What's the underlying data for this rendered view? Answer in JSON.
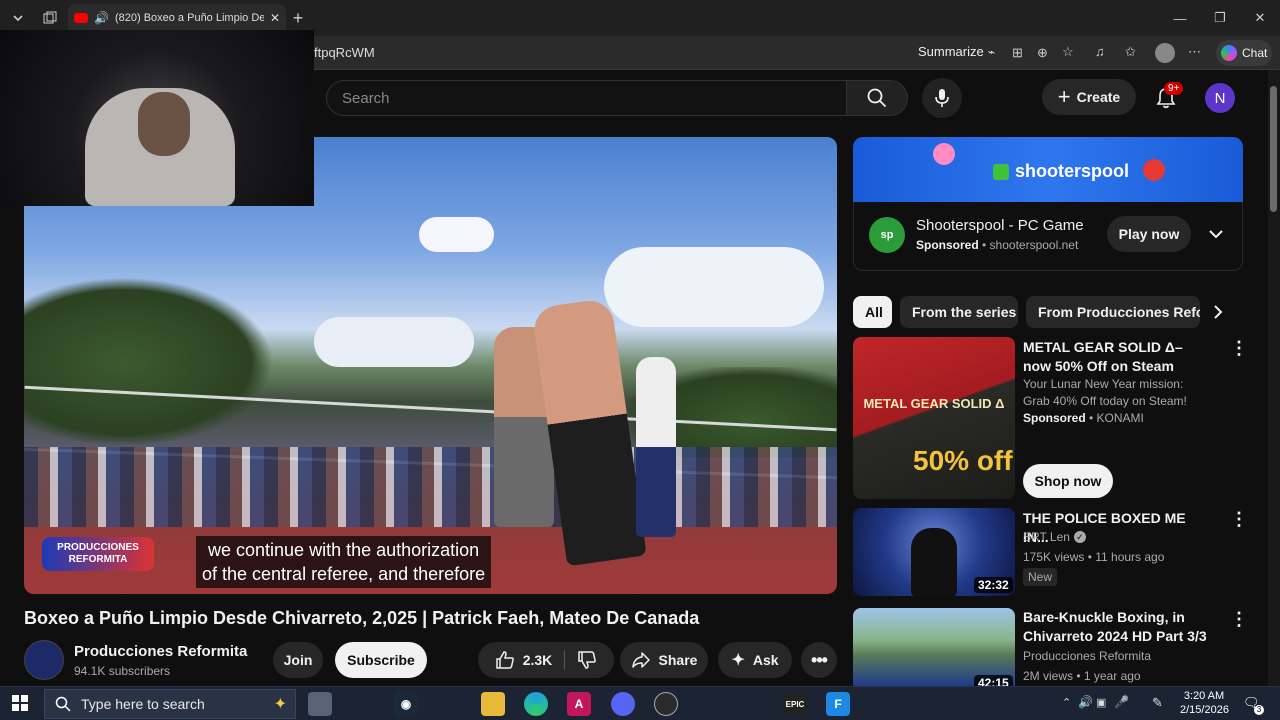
{
  "browser": {
    "tab_title": "(820) Boxeo a Puño Limpio De",
    "new_tab_symbol": "+",
    "url_fragment": "ftpqRcWM",
    "summarize_label": "Summarize",
    "chat_label": "Chat",
    "window_controls": [
      "—",
      "❐",
      "✕"
    ]
  },
  "header": {
    "search_placeholder": "Search",
    "create_label": "Create",
    "notif_badge": "9+",
    "avatar_letter": "N"
  },
  "video": {
    "caption_line1": "we continue with the authorization",
    "caption_line2": "of the central referee, and therefore",
    "watermark": "PRODUCCIONES REFORMITA",
    "title": "Boxeo a Puño Limpio Desde Chivarreto, 2,025 | Patrick Faeh, Mateo De Canada",
    "channel_name": "Producciones  Reformita",
    "subscribers": "94.1K subscribers",
    "join_label": "Join",
    "subscribe_label": "Subscribe",
    "likes": "2.3K",
    "share_label": "Share",
    "ask_label": "Ask"
  },
  "ad": {
    "banner_brand": "shooterspool",
    "title": "Shooterspool - PC Game",
    "sponsored": "Sponsored",
    "domain": "shooterspool.net",
    "cta": "Play now"
  },
  "chips": [
    "All",
    "From the series",
    "From Producciones Refor"
  ],
  "related": [
    {
      "title": "METAL GEAR SOLID Δ– now 50% Off on Steam",
      "desc": "Your Lunar New Year mission: Grab 40% Off today on Steam!",
      "sponsored": "Sponsored",
      "advertiser": "KONAMI",
      "cta": "Shop now",
      "thumb_text": "METAL GEAR SOLID Δ",
      "thumb_off": "50% off"
    },
    {
      "title": "THE POLICE BOXED ME IN...",
      "channel": "SRT Len",
      "meta": "175K views • 11 hours ago",
      "badge": "New",
      "duration": "32:32"
    },
    {
      "title": "Bare-Knuckle Boxing, in Chivarreto 2024 HD Part 3/3",
      "channel": "Producciones Reformita",
      "meta": "2M views • 1 year ago",
      "duration": "42:15"
    }
  ],
  "taskbar": {
    "search_placeholder": "Type here to search",
    "time": "3:20 AM",
    "date": "2/15/2026",
    "notif_count": "3",
    "epic_label": "EPIC"
  },
  "colors": {
    "accent_red": "#cc0000",
    "subscribe_bg": "#f1f1f1",
    "avatar_bg": "#5c35c9"
  }
}
